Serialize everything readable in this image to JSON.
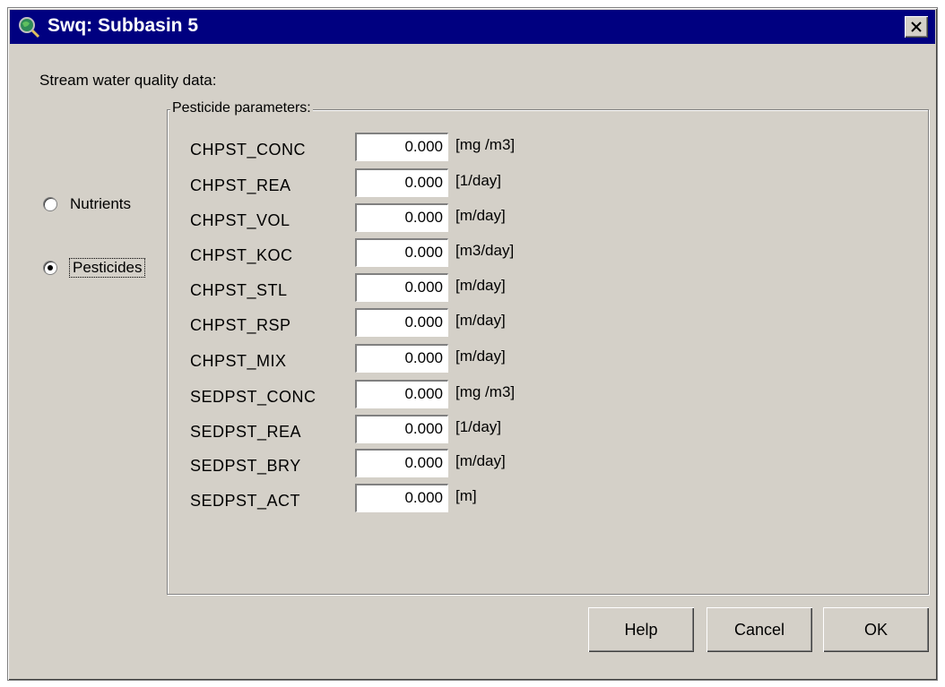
{
  "window": {
    "title": "Swq: Subbasin 5"
  },
  "heading": "Stream water quality data:",
  "radios": [
    {
      "label": "Nutrients",
      "selected": false
    },
    {
      "label": "Pesticides",
      "selected": true
    }
  ],
  "group_title": "Pesticide parameters:",
  "params": [
    {
      "name": "CHPST_CONC",
      "value": "0.000",
      "unit": "[mg /m3]"
    },
    {
      "name": "CHPST_REA",
      "value": "0.000",
      "unit": "[1/day]"
    },
    {
      "name": "CHPST_VOL",
      "value": "0.000",
      "unit": "[m/day]"
    },
    {
      "name": "CHPST_KOC",
      "value": "0.000",
      "unit": "[m3/day]"
    },
    {
      "name": "CHPST_STL",
      "value": "0.000",
      "unit": "[m/day]"
    },
    {
      "name": "CHPST_RSP",
      "value": "0.000",
      "unit": "[m/day]"
    },
    {
      "name": "CHPST_MIX",
      "value": "0.000",
      "unit": "[m/day]"
    },
    {
      "name": "SEDPST_CONC",
      "value": "0.000",
      "unit": "[mg /m3]"
    },
    {
      "name": "SEDPST_REA",
      "value": "0.000",
      "unit": "[1/day]"
    },
    {
      "name": "SEDPST_BRY",
      "value": "0.000",
      "unit": "[m/day]"
    },
    {
      "name": "SEDPST_ACT",
      "value": "0.000",
      "unit": "[m]"
    }
  ],
  "buttons": {
    "help": "Help",
    "cancel": "Cancel",
    "ok": "OK"
  }
}
